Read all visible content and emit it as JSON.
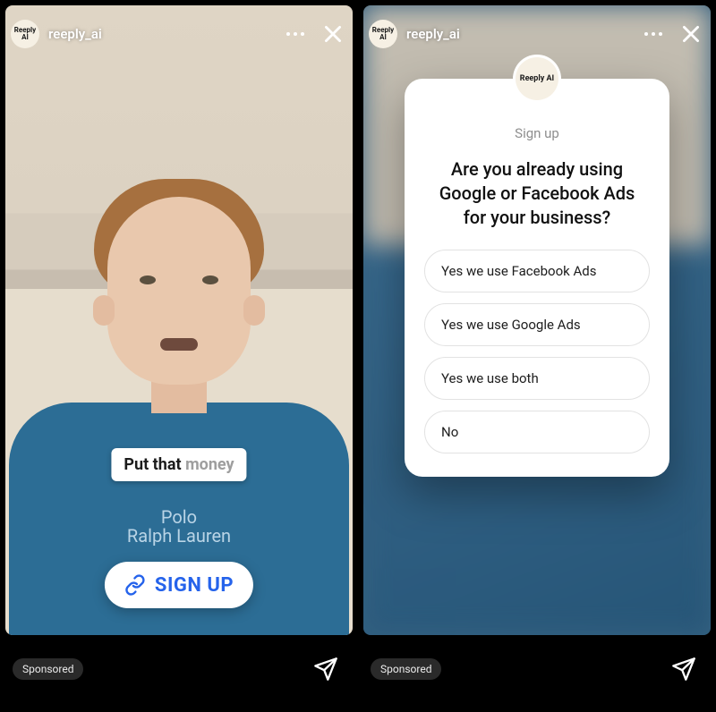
{
  "left": {
    "username": "reeply_ai",
    "avatar_text": "Reeply AI",
    "caption_strong": "Put that",
    "caption_fade": "money",
    "brand_line1": "Polo",
    "brand_line2": "Ralph Lauren",
    "cta_label": "SIGN UP",
    "sponsored": "Sponsored"
  },
  "right": {
    "username": "reeply_ai",
    "avatar_text": "Reeply AI",
    "sponsored": "Sponsored",
    "card": {
      "avatar_text": "Reeply AI",
      "kicker": "Sign up",
      "question": "Are you already using Google or Facebook Ads for your business?",
      "options": [
        "Yes we use Facebook Ads",
        "Yes we use Google Ads",
        "Yes we use both",
        "No"
      ]
    }
  }
}
